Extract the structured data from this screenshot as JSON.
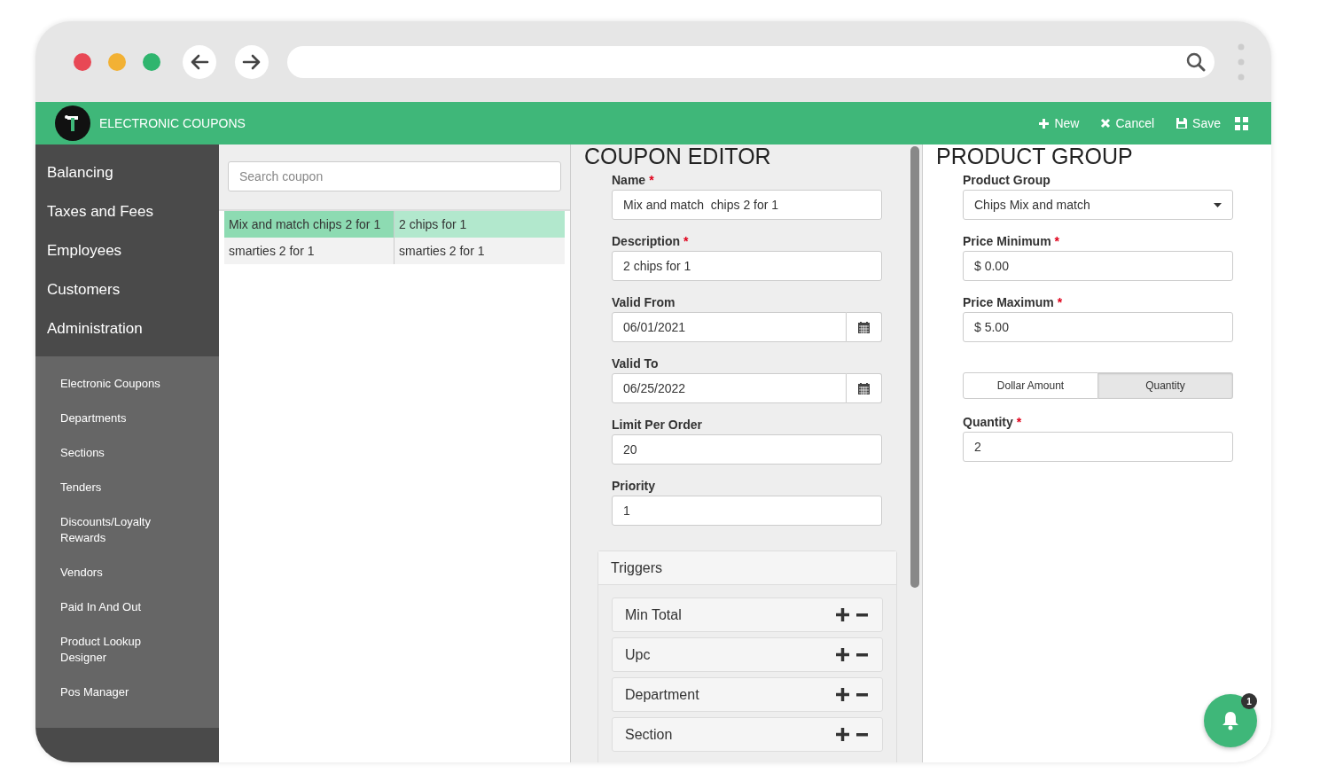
{
  "app": {
    "title": "ELECTRONIC COUPONS"
  },
  "toolbar": [
    {
      "kind": "new",
      "label": "New"
    },
    {
      "kind": "cancel",
      "label": "Cancel"
    },
    {
      "kind": "save",
      "label": "Save"
    },
    {
      "kind": "grid"
    }
  ],
  "sidebar": {
    "items": [
      {
        "label": "Balancing"
      },
      {
        "label": "Taxes and Fees"
      },
      {
        "label": "Employees"
      },
      {
        "label": "Customers"
      },
      {
        "label": "Administration"
      }
    ],
    "subitems": [
      {
        "label": "Electronic Coupons"
      },
      {
        "label": "Departments"
      },
      {
        "label": "Sections"
      },
      {
        "label": "Tenders"
      },
      {
        "label": "Discounts/Loyalty Rewards"
      },
      {
        "label": "Vendors"
      },
      {
        "label": "Paid In And Out"
      },
      {
        "label": "Product Lookup Designer"
      },
      {
        "label": "Pos Manager"
      }
    ]
  },
  "coupon_list": {
    "search": {
      "placeholder": "Search coupon"
    },
    "rows": [
      {
        "selected": true,
        "cells": [
          "Mix and match chips 2 for 1",
          "2 chips for 1"
        ]
      },
      {
        "selected": false,
        "cells": [
          "smarties 2 for 1",
          "smarties 2 for 1"
        ]
      }
    ]
  },
  "coupon_editor": {
    "title": "COUPON EDITOR",
    "fields": [
      {
        "kind": "text",
        "label": "Name",
        "required": "*",
        "value": "Mix and match  chips 2 for 1"
      },
      {
        "kind": "text",
        "label": "Description",
        "required": "*",
        "value": "2 chips for 1"
      },
      {
        "kind": "date",
        "label": "Valid From",
        "value": "06/01/2021"
      },
      {
        "kind": "date",
        "label": "Valid To",
        "value": "06/25/2022"
      },
      {
        "kind": "text",
        "label": "Limit Per Order",
        "value": "20"
      },
      {
        "kind": "text",
        "label": "Priority",
        "value": "1"
      }
    ],
    "triggers": {
      "title": "Triggers",
      "items": [
        {
          "label": "Min Total"
        },
        {
          "label": "Upc"
        },
        {
          "label": "Department"
        },
        {
          "label": "Section"
        }
      ]
    }
  },
  "product_group": {
    "title": "PRODUCT GROUP",
    "fields": [
      {
        "kind": "select",
        "label": "Product Group",
        "value": "Chips Mix and match"
      },
      {
        "kind": "text",
        "label": "Price Minimum",
        "required": "*",
        "value": "$ 0.00"
      },
      {
        "kind": "text",
        "label": "Price Maximum",
        "required": "*",
        "value": "$ 5.00"
      }
    ],
    "mode": [
      {
        "label": "Dollar Amount",
        "selected": false
      },
      {
        "label": "Quantity",
        "selected": true
      }
    ],
    "quantity": {
      "label": "Quantity",
      "required": "*",
      "value": "2"
    }
  },
  "notifications": {
    "count": "1"
  }
}
